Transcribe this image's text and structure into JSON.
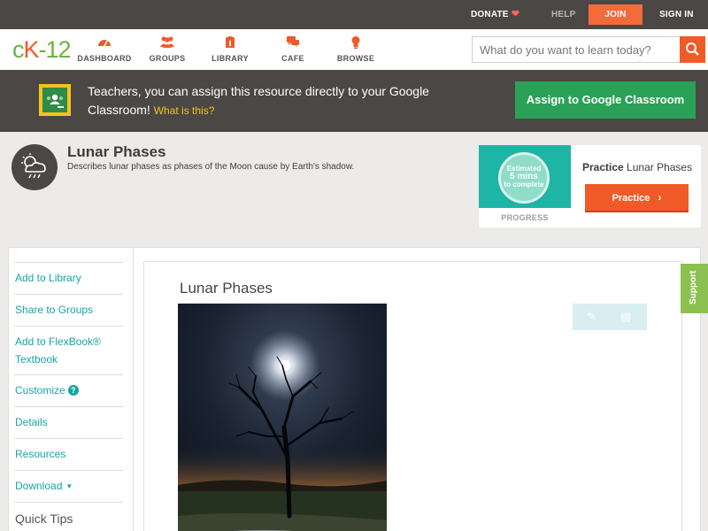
{
  "topbar": {
    "donate": "DONATE",
    "help": "HELP",
    "join": "JOIN",
    "signin": "SIGN IN"
  },
  "nav": {
    "logo": {
      "c": "c",
      "k": "K",
      "n": "-12"
    },
    "items": [
      {
        "label": "DASHBOARD",
        "icon": "dashboard-icon"
      },
      {
        "label": "GROUPS",
        "icon": "groups-icon"
      },
      {
        "label": "LIBRARY",
        "icon": "library-icon"
      },
      {
        "label": "CAFE",
        "icon": "cafe-icon"
      },
      {
        "label": "BROWSE",
        "icon": "browse-icon"
      }
    ],
    "search_placeholder": "What do you want to learn today?"
  },
  "banner": {
    "message": "Teachers, you can assign this resource directly to your Google Classroom!",
    "what_link": "What is this?",
    "assign_button": "Assign to Google Classroom"
  },
  "lesson": {
    "title": "Lunar Phases",
    "description": "Describes lunar phases as phases of the Moon cause by Earth's shadow."
  },
  "practice": {
    "estimated": "Estimated",
    "mins": "5 mins",
    "to_complete": "to complete",
    "progress_label": "PROGRESS",
    "title_bold": "Practice",
    "title_rest": "Lunar Phases",
    "button": "Practice"
  },
  "sidebar": {
    "items": [
      {
        "label": "Add to Library"
      },
      {
        "label": "Share to Groups"
      },
      {
        "label": "Add to FlexBook®"
      },
      {
        "label": "Textbook"
      },
      {
        "label": "Customize"
      },
      {
        "label": "Details"
      },
      {
        "label": "Resources"
      },
      {
        "label": "Download"
      },
      {
        "label": "Quick Tips"
      }
    ]
  },
  "main": {
    "title": "Lunar Phases"
  },
  "support": "Support",
  "colors": {
    "accent_orange": "#f05a28",
    "teal_link": "#1aa3a7",
    "google_green": "#2aa157",
    "dark_bar": "#4a4745"
  }
}
